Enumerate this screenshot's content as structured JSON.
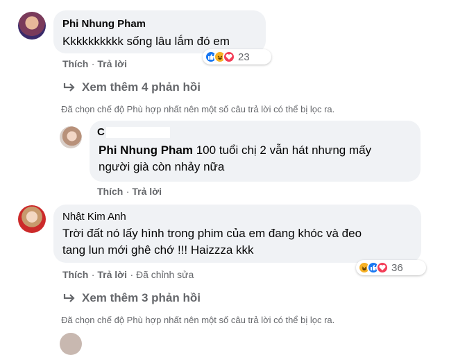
{
  "comment1": {
    "author": "Phi Nhung Pham",
    "text": "Kkkkkkkkkk sống lâu lắm đó em",
    "like_label": "Thích",
    "reply_label": "Trả lời",
    "reaction_count": "23",
    "reactions": [
      "like-icon",
      "haha-icon",
      "love-icon"
    ]
  },
  "more1": {
    "label": "Xem thêm 4 phản hồi",
    "icon": "reply-arrow-icon"
  },
  "filter1": "Đã chọn chế độ Phù hợp nhất nên một số câu trả lời có thể bị lọc ra.",
  "reply1": {
    "author": "C",
    "tagged_name": "Phi Nhung Pham",
    "text_line1": " 100 tuổi chị 2 vẫn hát nhưng mấy",
    "text_line2": "người già còn nhảy nữa",
    "like_label": "Thích",
    "reply_label": "Trả lời"
  },
  "comment2": {
    "author": "Nhật Kim Anh",
    "text_line1": "Trời đất nó lấy hình trong phim của em đang khóc và đeo",
    "text_line2": "tang lun mới ghê chớ !!! Haizzza kkk",
    "like_label": "Thích",
    "reply_label": "Trả lời",
    "edited_label": "Đã chỉnh sửa",
    "reaction_count": "36",
    "reactions": [
      "haha-icon",
      "like-icon",
      "love-icon"
    ]
  },
  "more2": {
    "label": "Xem thêm 3 phản hồi",
    "icon": "reply-arrow-icon"
  },
  "filter2": "Đã chọn chế độ Phù hợp nhất nên một số câu trả lời có thể bị lọc ra.",
  "colors": {
    "like": "#1877f2",
    "love": "#f33e58",
    "haha": "#f7b125",
    "secondary_text": "#65676b",
    "bubble": "#f0f2f5"
  }
}
